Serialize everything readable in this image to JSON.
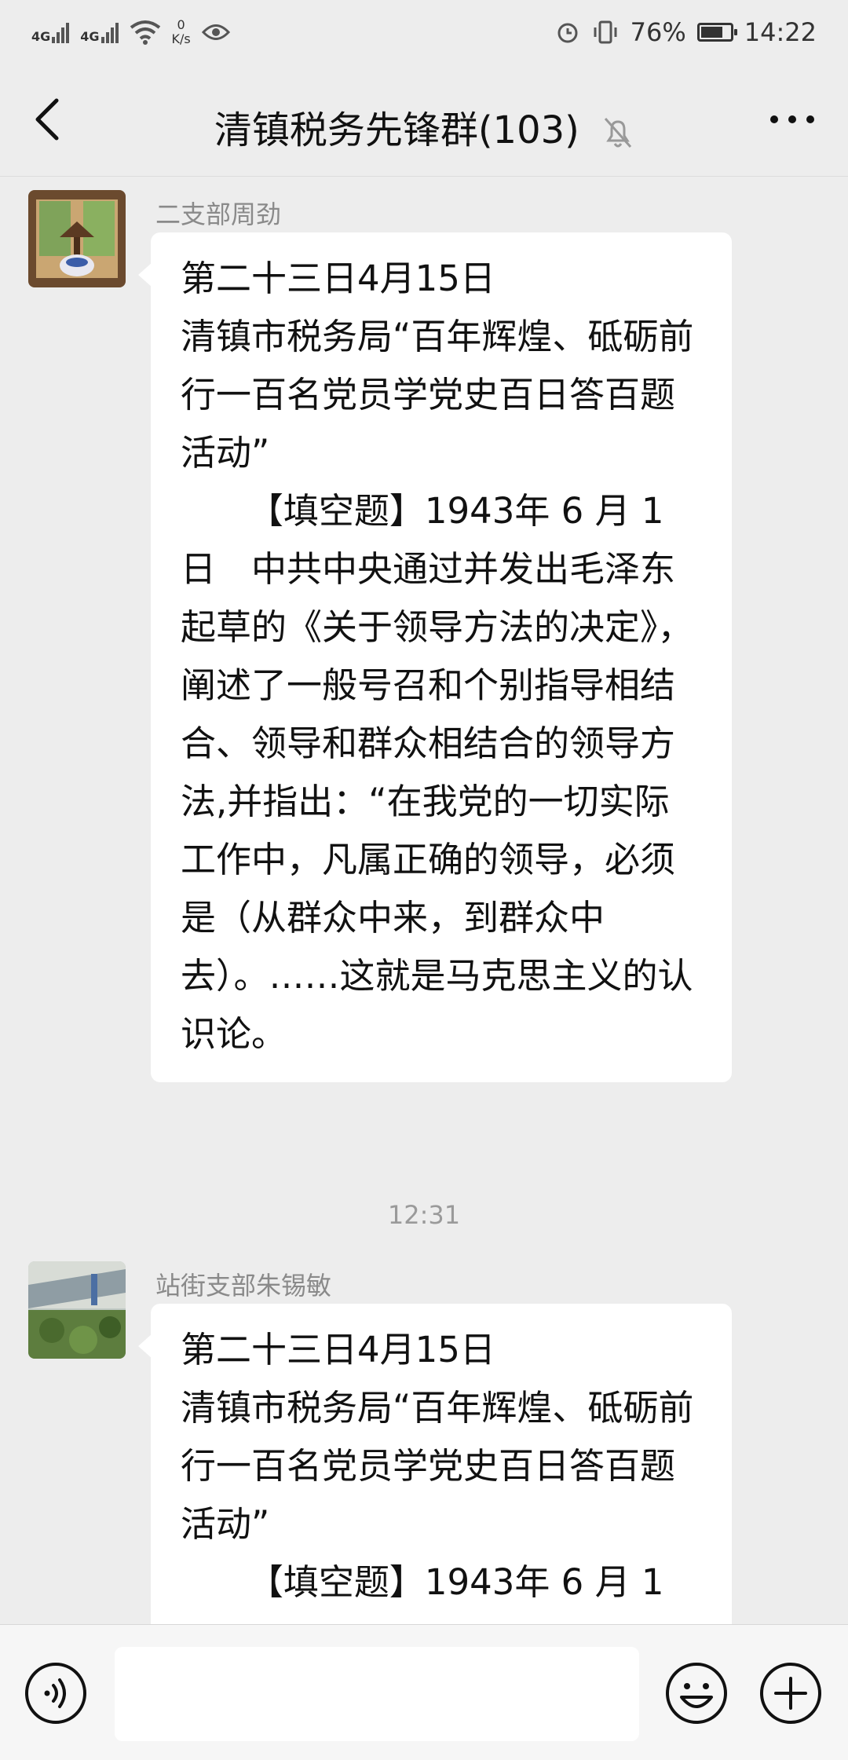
{
  "status_bar": {
    "network_1": "4G",
    "network_2": "4G",
    "net_speed_value": "0",
    "net_speed_unit": "K/s",
    "battery_percent": "76%",
    "battery_level": 0.76,
    "time": "14:22"
  },
  "header": {
    "title": "清镇税务先锋群(103)"
  },
  "messages": [
    {
      "sender": "二支部周劲",
      "text": "第二十三日4月15日\n清镇市税务局“百年辉煌、砥砺前行一百名党员学党史百日答百题活动”\n      【填空题】1943年 6 月 1 日　中共中央通过并发出毛泽东起草的《关于领导方法的决定》，阐述了一般号召和个别指导相结合、领导和群众相结合的领导方法,并指出：“在我党的一切实际工作中，凡属正确的领导，必须是（从群众中来，到群众中去）。……这就是马克思主义的认识论。"
    },
    {
      "sender": "站街支部朱锡敏",
      "text": "第二十三日4月15日\n清镇市税务局“百年辉煌、砥砺前行一百名党员学党史百日答百题活动”\n      【填空题】1943年 6 月 1"
    }
  ],
  "timestamp": "12:31",
  "input": {
    "value": "",
    "placeholder": ""
  },
  "icons": {
    "back": "back-arrow-icon",
    "mute": "bell-off-icon",
    "more": "more-dots-icon",
    "voice": "voice-icon",
    "emoji": "emoji-icon",
    "plus": "plus-icon",
    "eye": "eye-icon",
    "alarm": "alarm-icon",
    "vibrate": "vibrate-icon"
  }
}
